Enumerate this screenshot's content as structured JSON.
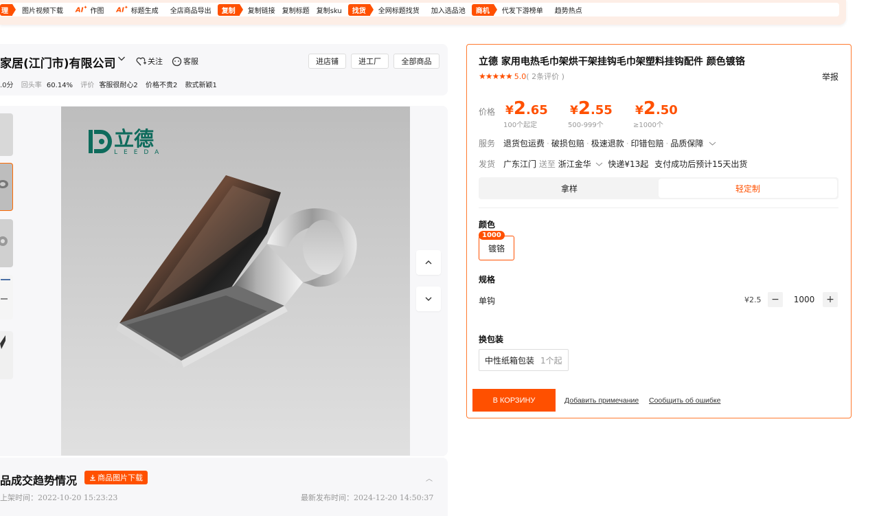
{
  "toolbar": {
    "tag_manage": "理",
    "img_video_download": "图片视频下载",
    "ai_label": "AI",
    "ai_draw": "作图",
    "ai_title_gen": "标题生成",
    "export_all": "全店商品导出",
    "tag_copy": "复制",
    "copy_link": "复制链接",
    "copy_title": "复制标题",
    "copy_sku": "复制sku",
    "tag_find": "找货",
    "find_by_title": "全网标题找货",
    "add_pool": "加入选品池",
    "tag_opportunity": "商机",
    "dropship_rank": "代发下游榜单",
    "trend_hot": "趋势热点"
  },
  "store": {
    "name": "家居(江门市)有限公司",
    "follow": "关注",
    "service": "客服",
    "btn_store": "进店铺",
    "btn_factory": "进工厂",
    "btn_all": "全部商品",
    "score": ".0分",
    "repurchase_label": "回头率",
    "repurchase_value": "60.14%",
    "review_label": "评价",
    "review_tag1": "客服很耐心2",
    "review_tag2": "价格不贵2",
    "review_tag3": "款式新颖1"
  },
  "gallery": {
    "brand_text": "立德",
    "brand_sub": "LEEDA"
  },
  "trend": {
    "title": "品成交趋势情况",
    "download_btn": "商品图片下载",
    "listed_time": "上架时间：2022-10-20 15:23:23",
    "latest_time": "最新发布时间：2024-12-20 14:50:37"
  },
  "product": {
    "title": "立德 家用电热毛巾架烘干架挂钩毛巾架塑料挂钩配件 颜色镀铬",
    "stars": "★★★★★",
    "rating": "5.0",
    "review_count": "( 2条评价 )",
    "report": "举报",
    "price_label": "价格",
    "prices": [
      {
        "cur": "¥",
        "int": "2",
        "dec": ".65",
        "range": "100个起定"
      },
      {
        "cur": "¥",
        "int": "2",
        "dec": ".55",
        "range": "500-999个"
      },
      {
        "cur": "¥",
        "int": "2",
        "dec": ".50",
        "range": "≥1000个"
      }
    ],
    "service_label": "服务",
    "services": [
      "退货包运费",
      "破损包赔",
      "极速退款",
      "印错包赔",
      "品质保障"
    ],
    "ship_label": "发货",
    "ship_from": "广东江门",
    "ship_to_word": "送至",
    "ship_to": "浙江金华",
    "ship_fee": "快递¥13起",
    "ship_time": "支付成功后预计15天出货",
    "mode_sample": "拿样",
    "mode_custom": "轻定制",
    "color_title": "颜色",
    "color_badge": "1000",
    "color_option": "镀铬",
    "spec_title": "规格",
    "spec_name": "单钩",
    "spec_price": "¥2.5",
    "qty": "1000",
    "pack_title": "换包装",
    "pack_option": "中性纸箱包装",
    "pack_min": "1个起",
    "cart_btn": "В КОРЗИНУ",
    "link_note": "Добавить примечание",
    "link_error": "Сообщить об ошибке"
  },
  "colors": {
    "accent": "#ff5000",
    "panel_border": "#ff7a2e"
  }
}
